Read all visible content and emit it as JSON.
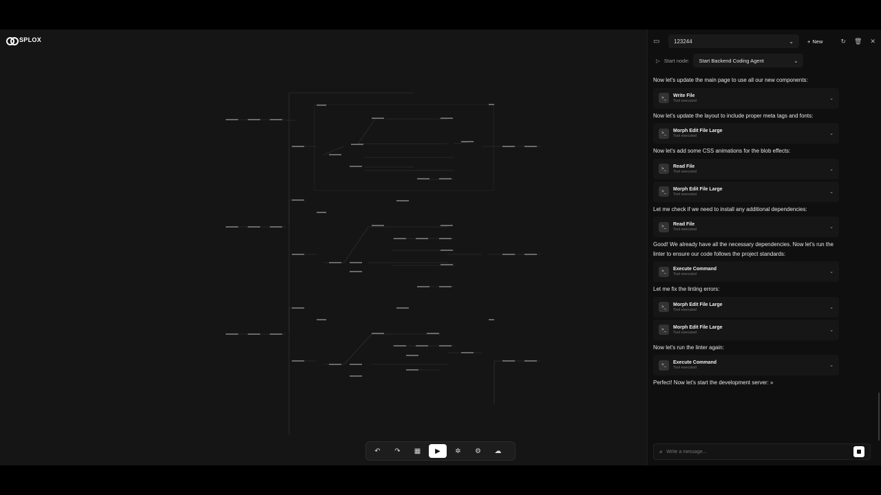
{
  "brand": {
    "name": "SPLOX"
  },
  "toolbar": {
    "buttons": [
      {
        "name": "undo-icon",
        "glyph": "↶"
      },
      {
        "name": "redo-icon",
        "glyph": "↷"
      },
      {
        "name": "grid-icon",
        "glyph": "▦"
      },
      {
        "name": "run-icon",
        "glyph": "▶"
      },
      {
        "name": "bug-icon",
        "glyph": "✲"
      },
      {
        "name": "settings-icon",
        "glyph": "⚙"
      },
      {
        "name": "cloud-upload-icon",
        "glyph": "☁"
      }
    ]
  },
  "panel": {
    "chat_id": "123244",
    "new_label": "New",
    "start_node_label": "Start node:",
    "start_node_value": "Start Backend Coding Agent"
  },
  "messages": [
    {
      "type": "text",
      "text": "Now let's update the main page to use all our new components:"
    },
    {
      "type": "tool",
      "name": "Write File",
      "status": "Tool executed"
    },
    {
      "type": "text",
      "text": "Now let's update the layout to include proper meta tags and fonts:"
    },
    {
      "type": "tool",
      "name": "Morph Edit File Large",
      "status": "Tool executed"
    },
    {
      "type": "text",
      "text": "Now let's add some CSS animations for the blob effects:"
    },
    {
      "type": "tool",
      "name": "Read File",
      "status": "Tool executed"
    },
    {
      "type": "tool",
      "name": "Morph Edit File Large",
      "status": "Tool executed"
    },
    {
      "type": "text",
      "text": "Let me check if we need to install any additional dependencies:"
    },
    {
      "type": "tool",
      "name": "Read File",
      "status": "Tool executed"
    },
    {
      "type": "text",
      "text": "Good! We already have all the necessary dependencies. Now let's run the linter to ensure our code follows the project standards:"
    },
    {
      "type": "tool",
      "name": "Execute Command",
      "status": "Tool executed"
    },
    {
      "type": "text",
      "text": "Let me fix the linting errors:"
    },
    {
      "type": "tool",
      "name": "Morph Edit File Large",
      "status": "Tool executed"
    },
    {
      "type": "tool",
      "name": "Morph Edit File Large",
      "status": "Tool executed"
    },
    {
      "type": "text",
      "text": "Now let's run the linter again:"
    },
    {
      "type": "tool",
      "name": "Execute Command",
      "status": "Tool executed"
    },
    {
      "type": "text",
      "text": "Perfect! Now let's start the development server: »"
    }
  ],
  "input": {
    "placeholder": "Write a message..."
  }
}
